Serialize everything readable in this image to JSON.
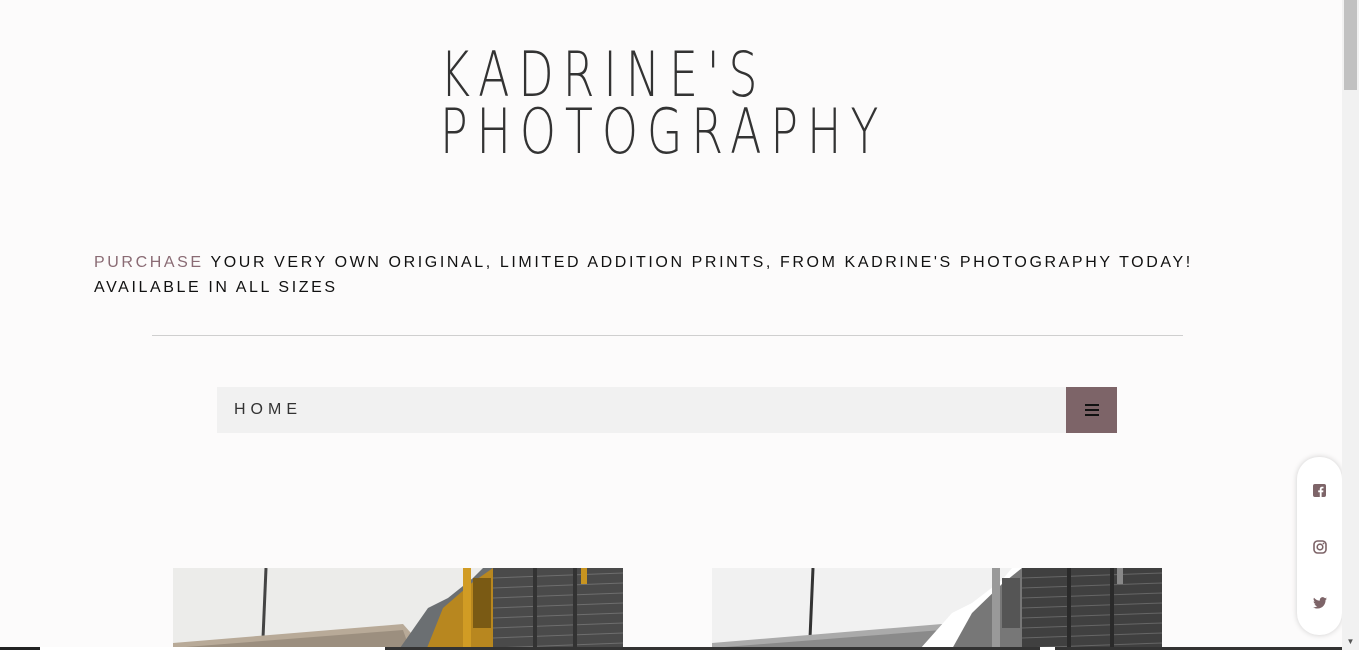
{
  "header": {
    "title_line1": "KADRINE'S",
    "title_line2": "PHOTOGRAPHY"
  },
  "tagline": {
    "accent": "PURCHASE",
    "rest": " YOUR VERY OWN ORIGINAL, LIMITED ADDITION PRINTS, FROM KADRINE'S PHOTOGRAPHY TODAY!",
    "line2": "AVAILABLE IN ALL SIZES"
  },
  "nav": {
    "home_label": "HOME",
    "menu_icon": "hamburger-menu-icon"
  },
  "gallery": {
    "items": [
      {
        "style": "color"
      },
      {
        "style": "black-and-white"
      }
    ]
  },
  "social": {
    "icons": [
      "facebook-icon",
      "instagram-icon",
      "twitter-icon"
    ]
  },
  "colors": {
    "accent": "#8a6b74",
    "menu_button": "#7d6468",
    "nav_background": "#f1f1f1"
  }
}
